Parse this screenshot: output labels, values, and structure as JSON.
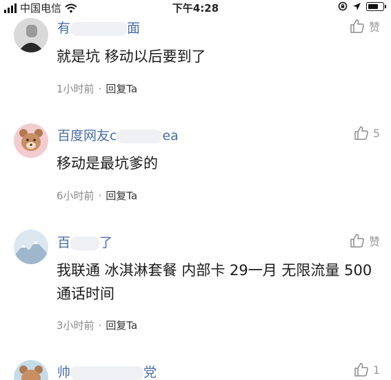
{
  "status_bar": {
    "carrier": "中国电信",
    "time": "下午4:28",
    "battery_level": 0.75
  },
  "comments": [
    {
      "name_start": "有",
      "name_end": "面",
      "text": "就是坑 移动以后要到了",
      "time_ago": "1小时前",
      "dot": "·",
      "reply": "回复Ta",
      "like_label": "赞"
    },
    {
      "name_start": "百度网友c",
      "name_end": "ea",
      "text": "移动是最坑爹的",
      "time_ago": "6小时前",
      "dot": "·",
      "reply": "回复Ta",
      "like_label": "5"
    },
    {
      "name_start": "百",
      "name_end": "了",
      "text": "我联通 冰淇淋套餐 内部卡 29一月 无限流量 500通话时间",
      "time_ago": "3小时前",
      "dot": "·",
      "reply": "回复Ta",
      "like_label": "赞"
    },
    {
      "name_start": "帅",
      "name_end": "党",
      "like_label": "1"
    }
  ],
  "icons": {
    "like": "thumbs-up-icon",
    "wifi": "wifi-icon",
    "location": "location-arrow-icon",
    "lock": "rotation-lock-icon"
  }
}
